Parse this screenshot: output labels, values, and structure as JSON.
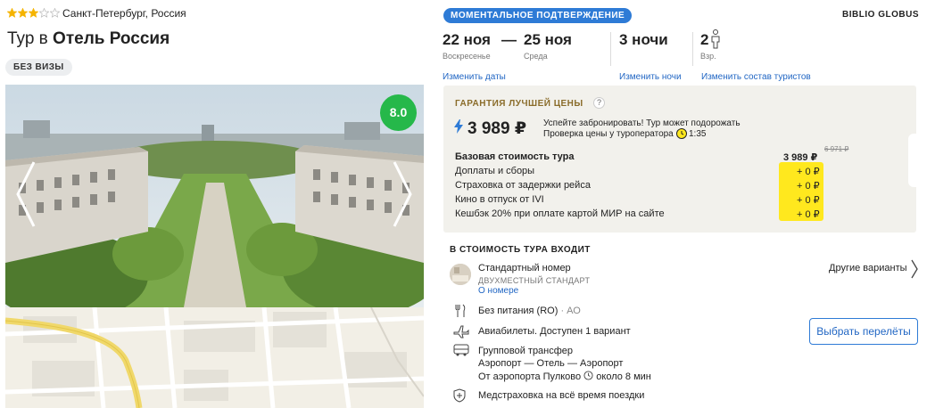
{
  "hotel": {
    "stars": 3,
    "stars_max": 5,
    "location": "Санкт-Петербург, Россия",
    "title_prefix": "Тур в",
    "title_name": "Отель Россия",
    "visa_badge": "БЕЗ ВИЗЫ",
    "rating": "8.0"
  },
  "tour": {
    "instant_badge": "МОМЕНТАЛЬНОЕ ПОДТВЕРЖДЕНИЕ",
    "operator": "BIBLIO GLOBUS",
    "date_from": "22 ноя",
    "dash": "—",
    "date_to": "25 ноя",
    "day_from": "Воскресенье",
    "day_to": "Среда",
    "nights": "3 ночи",
    "tourists": "2",
    "tourists_label": "Взр.",
    "link_dates": "Изменить даты",
    "link_nights": "Изменить ночи",
    "link_tourists": "Изменить состав туристов"
  },
  "price": {
    "guarantee": "ГАРАНТИЯ ЛУЧШЕЙ ЦЕНЫ",
    "help": "?",
    "main": "3 989 ₽",
    "warning_line1": "Успейте забронировать! Тур может подорожать",
    "warning_line2": "Проверка цены у туроператора",
    "timer": "1:35",
    "base_label": "Базовая стоимость тура",
    "base_value": "3 989 ₽",
    "old_value": "6 971 ₽",
    "extras": [
      {
        "label": "Доплаты и сборы",
        "value": "+ 0 ₽"
      },
      {
        "label": "Страховка от задержки рейса",
        "value": "+ 0 ₽"
      },
      {
        "label": "Кино в отпуск от IVI",
        "value": "+ 0 ₽"
      },
      {
        "label": "Кешбэк 20% при оплате картой МИР на сайте",
        "value": "+ 0 ₽"
      }
    ],
    "accent_color": "#ffe81e"
  },
  "included": {
    "title": "В СТОИМОСТЬ ТУРА ВХОДИТ",
    "room": "Стандартный номер",
    "room_type": "ДВУХМЕСТНЫЙ СТАНДАРТ",
    "room_link": "О номере",
    "other_variants": "Другие варианты",
    "meal": "Без питания (RO)",
    "meal_code": "· АО",
    "flights": "Авиабилеты. Доступен 1 вариант",
    "flights_button": "Выбрать перелёты",
    "transfer": "Групповой трансфер",
    "transfer_route": "Аэропорт — Отель — Аэропорт",
    "transfer_time_prefix": "От аэропорта Пулково",
    "transfer_time": "около 8 мин",
    "insurance": "Медстраховка на всё время поездки"
  }
}
